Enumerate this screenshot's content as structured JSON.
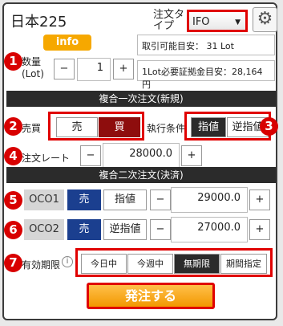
{
  "header": {
    "title": "日本225",
    "order_type_label": "注文タイプ",
    "order_type_value": "IFO",
    "info_label": "info"
  },
  "account": {
    "available_lots": "取引可能目安： 31 Lot",
    "margin_per_lot": "1Lot必要証拠金目安：28,164円"
  },
  "quantity": {
    "label": "数量(Lot)",
    "value": "1"
  },
  "sections": {
    "primary": "複合一次注文(新規)",
    "secondary": "複合二次注文(決済)"
  },
  "side": {
    "label": "売買",
    "sell": "売",
    "buy": "買",
    "condition_label": "執行条件",
    "limit": "指値",
    "stop": "逆指値"
  },
  "rate": {
    "label": "注文レート",
    "value": "28000.0"
  },
  "oco1": {
    "label": "OCO1",
    "side": "売",
    "type": "指値",
    "value": "29000.0"
  },
  "oco2": {
    "label": "OCO2",
    "side": "売",
    "type": "逆指値",
    "value": "27000.0"
  },
  "expiry": {
    "label": "有効期限",
    "options": [
      "今日中",
      "今週中",
      "無期限",
      "期間指定"
    ]
  },
  "submit": "発注する",
  "callouts": [
    "1",
    "2",
    "3",
    "4",
    "5",
    "6",
    "7"
  ],
  "buttons": {
    "minus": "−",
    "plus": "+"
  }
}
